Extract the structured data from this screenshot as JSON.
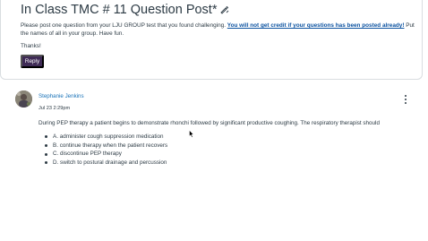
{
  "post": {
    "title": "In Class TMC # 11 Question Post*",
    "body_intro": "Please post one question from your LJU GROUP test that you found challenging. ",
    "body_warning": "You will not get credit if your questions has been posted already!",
    "body_outro": " Put the names of all in your group. Have fun.",
    "thanks": "Thanks!",
    "reply_label": "Reply"
  },
  "reply": {
    "author": "Stephanie Jenkins",
    "date": "Jul 23 2:29pm",
    "question": "During PEP therapy a patient begins to demonstrate rhonchi followed by significant productive coughing. The respiratory therapist should",
    "options": [
      "A.  administer cough suppression medication",
      "B.  continue therapy when the patient recovers",
      "C.  discontinue PEP therapy",
      "D.  switch to postural drainage and percussion"
    ]
  },
  "colors": {
    "reply_button": "#3f2b56",
    "link": "#0b52a0",
    "author": "#1a73b8",
    "text": "#2d3b45"
  },
  "icons": {
    "title_icon": "edit-pencil-icon",
    "more": "more-options-icon",
    "cursor": "mouse-cursor-icon"
  }
}
